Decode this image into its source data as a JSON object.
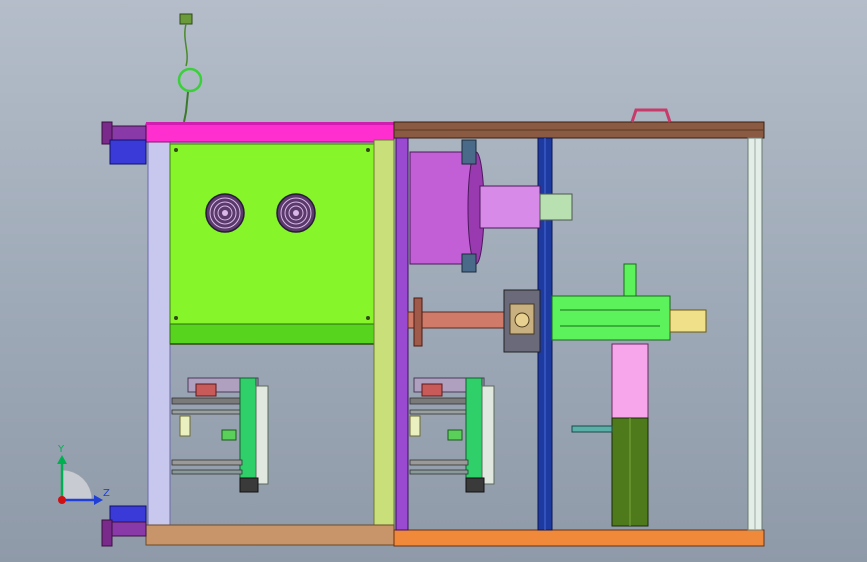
{
  "viewport": {
    "background_top": "#b4bdc9",
    "background_bottom": "#8f9aa9"
  },
  "triad": {
    "y_label": "Y",
    "z_label": "Z",
    "y_color": "#00b050",
    "z_color": "#1f3fd6",
    "origin_color": "#d01010"
  },
  "colors": {
    "top_beam": "#ff2fcf",
    "control_panel": "#86f52a",
    "cylinder": "#c25fd6",
    "column": "#1d3aa0",
    "green_block": "#5cf25c",
    "pink_slide": "#f7a6ec",
    "dark_green_motor": "#4f7a1c",
    "bottom_beam_left": "#c8956a",
    "bottom_beam_right": "#f08a3a",
    "frame_brown": "#8a5a42",
    "blue_foot": "#3a3ad8"
  }
}
